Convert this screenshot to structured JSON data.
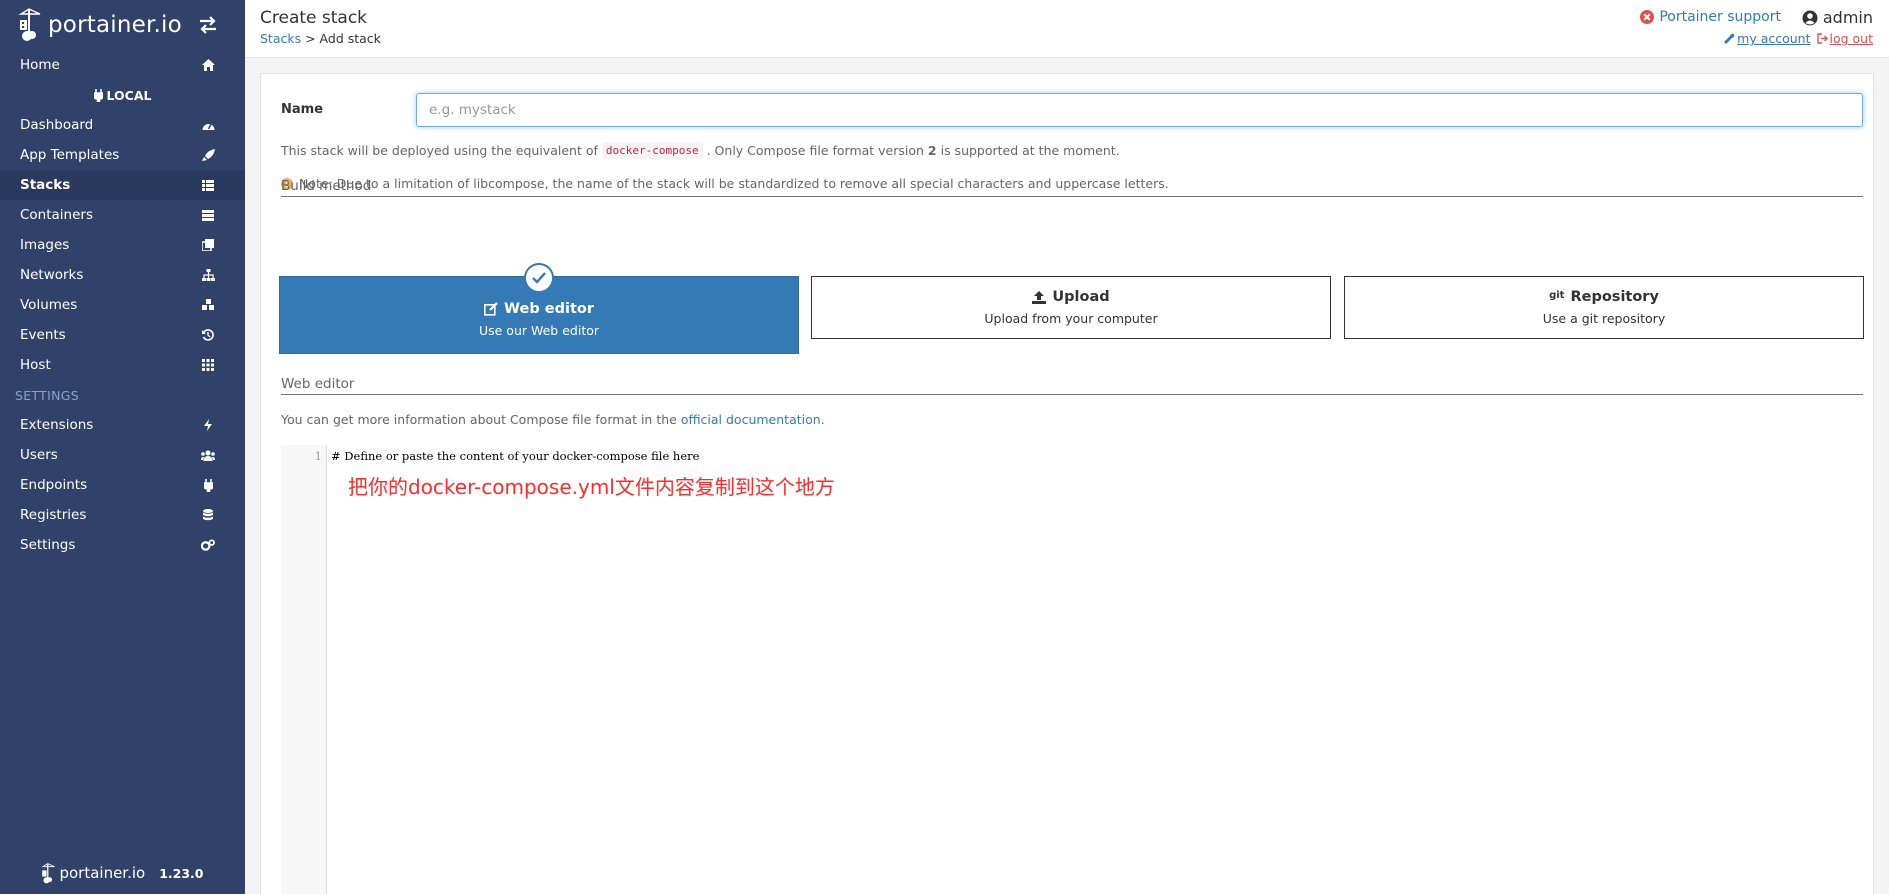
{
  "brand": {
    "name": "portainer.io",
    "version": "1.23.0"
  },
  "sidebar": {
    "home": "Home",
    "endpoint": "LOCAL",
    "items": [
      {
        "label": "Dashboard",
        "icon": "tachometer-icon"
      },
      {
        "label": "App Templates",
        "icon": "rocket-icon"
      },
      {
        "label": "Stacks",
        "icon": "th-list-icon",
        "active": true
      },
      {
        "label": "Containers",
        "icon": "list-icon"
      },
      {
        "label": "Images",
        "icon": "clone-icon"
      },
      {
        "label": "Networks",
        "icon": "sitemap-icon"
      },
      {
        "label": "Volumes",
        "icon": "cubes-icon"
      },
      {
        "label": "Events",
        "icon": "history-icon"
      },
      {
        "label": "Host",
        "icon": "th-icon"
      }
    ],
    "settings_section": "SETTINGS",
    "settings_items": [
      {
        "label": "Extensions",
        "icon": "bolt-icon"
      },
      {
        "label": "Users",
        "icon": "users-icon"
      },
      {
        "label": "Endpoints",
        "icon": "plug-icon"
      },
      {
        "label": "Registries",
        "icon": "database-icon"
      },
      {
        "label": "Settings",
        "icon": "cogs-icon"
      }
    ]
  },
  "header": {
    "title": "Create stack",
    "breadcrumb_link": "Stacks",
    "breadcrumb_sep": " > ",
    "breadcrumb_current": "Add stack",
    "support": "Portainer support",
    "user": "admin",
    "my_account": "my account",
    "logout": "log out"
  },
  "form": {
    "name_label": "Name",
    "name_placeholder": "e.g. mystack",
    "name_value": "",
    "info_prefix": "This stack will be deployed using the equivalent of",
    "info_code": "docker-compose",
    "info_mid": ". Only Compose file format version ",
    "info_version": "2",
    "info_suffix": " is supported at the moment.",
    "note": "Note: Due to a limitation of libcompose, the name of the stack will be standardized to remove all special characters and uppercase letters."
  },
  "build_method": {
    "title": "Build method",
    "options": [
      {
        "title": "Web editor",
        "desc": "Use our Web editor",
        "selected": true
      },
      {
        "title": "Upload",
        "desc": "Upload from your computer",
        "selected": false
      },
      {
        "title": "Repository",
        "prefix": "git",
        "desc": "Use a git repository",
        "selected": false
      }
    ]
  },
  "web_editor": {
    "title": "Web editor",
    "info_prefix": "You can get more information about Compose file format in the ",
    "info_link": "official documentation",
    "info_suffix": ".",
    "line_number": "1",
    "content": "# Define or paste the content of your docker-compose file here",
    "annotation": "把你的docker-compose.yml文件内容复制到这个地方"
  },
  "colors": {
    "sidebar": "#30426a",
    "accent": "#337ab7",
    "danger": "#d9534f",
    "annotation": "#ff2a2a"
  }
}
